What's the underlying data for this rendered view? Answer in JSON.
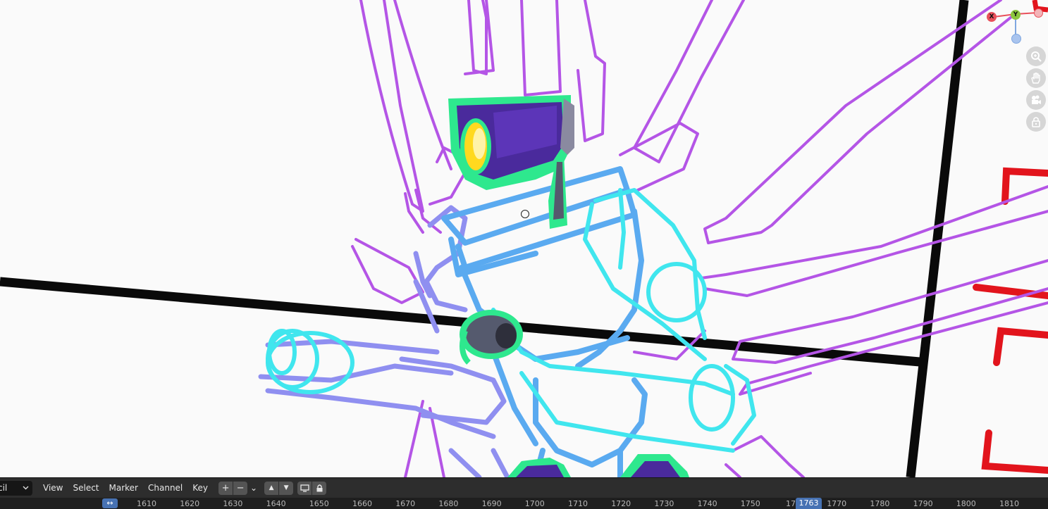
{
  "header": {
    "mode_select": "cil",
    "menus": [
      "View",
      "Select",
      "Marker",
      "Channel",
      "Key"
    ],
    "buttons": {
      "add": "+",
      "remove": "−",
      "dropdown": "⌄",
      "up": "▲",
      "down": "▼"
    }
  },
  "gizmo": {
    "x_label": "X",
    "y_label": "Y",
    "colors": {
      "x": "#e8505b",
      "y": "#8cc63f",
      "z": "#7fa7e0"
    }
  },
  "nav_icons": [
    "zoom-icon",
    "hand-pan-icon",
    "camera-icon",
    "lock-camera-icon"
  ],
  "timeline": {
    "fit_symbol": "↔",
    "ticks": [
      "1610",
      "1620",
      "1630",
      "1640",
      "1650",
      "1660",
      "1670",
      "1680",
      "1690",
      "1700",
      "1710",
      "1720",
      "1730",
      "1740",
      "1750",
      "17",
      "1770",
      "1780",
      "1790",
      "1800",
      "1810"
    ],
    "current_frame": "1763"
  },
  "colors": {
    "stroke_purple": "#b455e6",
    "stroke_periwinkle": "#8f8ff0",
    "stroke_blue": "#5aaaf0",
    "stroke_cyan": "#40e6ee",
    "stroke_green": "#2ee88e",
    "frame_red": "#e2141c",
    "accent_blue": "#4772b3"
  }
}
